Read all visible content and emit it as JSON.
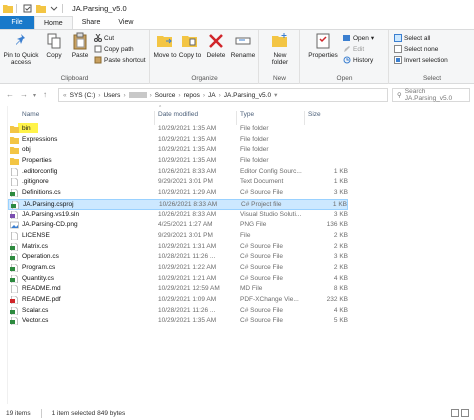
{
  "window": {
    "title": "JA.Parsing_v5.0"
  },
  "tabs": [
    {
      "label": "File"
    },
    {
      "label": "Home"
    },
    {
      "label": "Share"
    },
    {
      "label": "View"
    }
  ],
  "ribbon": {
    "clipboard": {
      "label": "Clipboard",
      "pin": "Pin to Quick access",
      "copy": "Copy",
      "paste": "Paste",
      "cut": "Cut",
      "copy_path": "Copy path",
      "paste_shortcut": "Paste shortcut"
    },
    "organize": {
      "label": "Organize",
      "move_to": "Move to",
      "copy_to": "Copy to",
      "delete": "Delete",
      "rename": "Rename"
    },
    "new": {
      "label": "New",
      "new_folder": "New folder"
    },
    "open": {
      "label": "Open",
      "properties": "Properties",
      "open": "Open",
      "edit": "Edit",
      "history": "History"
    },
    "select": {
      "label": "Select",
      "select_all": "Select all",
      "select_none": "Select none",
      "invert": "Invert selection"
    }
  },
  "address": {
    "crumbs": [
      "SYS (C:)",
      "Users",
      "Source",
      "repos",
      "JA",
      "JA.Parsing_v5.0"
    ],
    "search_placeholder": "Search JA.Parsing_v5.0"
  },
  "columns": {
    "name": "Name",
    "date": "Date modified",
    "type": "Type",
    "size": "Size"
  },
  "files": [
    {
      "name": "bin",
      "date": "10/29/2021 1:35 AM",
      "type": "File folder",
      "size": "",
      "icon": "folder"
    },
    {
      "name": "Expressions",
      "date": "10/29/2021 1:35 AM",
      "type": "File folder",
      "size": "",
      "icon": "folder"
    },
    {
      "name": "obj",
      "date": "10/29/2021 1:35 AM",
      "type": "File folder",
      "size": "",
      "icon": "folder"
    },
    {
      "name": "Properties",
      "date": "10/29/2021 1:35 AM",
      "type": "File folder",
      "size": "",
      "icon": "folder"
    },
    {
      "name": ".editorconfig",
      "date": "10/26/2021 8:33 AM",
      "type": "Editor Config Sourc...",
      "size": "1 KB",
      "icon": "file"
    },
    {
      "name": ".gitignore",
      "date": "9/29/2021 3:01 PM",
      "type": "Text Document",
      "size": "1 KB",
      "icon": "file"
    },
    {
      "name": "Definitions.cs",
      "date": "10/29/2021 1:29 AM",
      "type": "C# Source File",
      "size": "3 KB",
      "icon": "cs"
    },
    {
      "name": "JA.Parsing.csproj",
      "date": "10/26/2021 8:33 AM",
      "type": "C# Project file",
      "size": "1 KB",
      "icon": "cs"
    },
    {
      "name": "JA.Parsing.vs19.sln",
      "date": "10/26/2021 8:33 AM",
      "type": "Visual Studio Soluti...",
      "size": "3 KB",
      "icon": "sln"
    },
    {
      "name": "JA.Parsing-CD.png",
      "date": "4/25/2021 1:27 AM",
      "type": "PNG File",
      "size": "136 KB",
      "icon": "png"
    },
    {
      "name": "LICENSE",
      "date": "9/29/2021 3:01 PM",
      "type": "File",
      "size": "2 KB",
      "icon": "file"
    },
    {
      "name": "Matrix.cs",
      "date": "10/29/2021 1:31 AM",
      "type": "C# Source File",
      "size": "2 KB",
      "icon": "cs"
    },
    {
      "name": "Operation.cs",
      "date": "10/28/2021 11:26 ...",
      "type": "C# Source File",
      "size": "3 KB",
      "icon": "cs"
    },
    {
      "name": "Program.cs",
      "date": "10/29/2021 1:22 AM",
      "type": "C# Source File",
      "size": "2 KB",
      "icon": "cs"
    },
    {
      "name": "Quantity.cs",
      "date": "10/29/2021 1:21 AM",
      "type": "C# Source File",
      "size": "4 KB",
      "icon": "cs"
    },
    {
      "name": "README.md",
      "date": "10/29/2021 12:59 AM",
      "type": "MD File",
      "size": "8 KB",
      "icon": "file"
    },
    {
      "name": "README.pdf",
      "date": "10/29/2021 1:09 AM",
      "type": "PDF-XChange Vie...",
      "size": "232 KB",
      "icon": "pdf"
    },
    {
      "name": "Scalar.cs",
      "date": "10/28/2021 11:26 ...",
      "type": "C# Source File",
      "size": "4 KB",
      "icon": "cs"
    },
    {
      "name": "Vector.cs",
      "date": "10/29/2021 1:35 AM",
      "type": "C# Source File",
      "size": "5 KB",
      "icon": "cs"
    }
  ],
  "selected_index": 7,
  "status": {
    "items": "19 items",
    "selected": "1 item selected  849 bytes"
  },
  "colors": {
    "accent": "#1979ca",
    "selection": "#cce8ff",
    "folder": "#f3c544",
    "highlight": "#fff34a"
  }
}
